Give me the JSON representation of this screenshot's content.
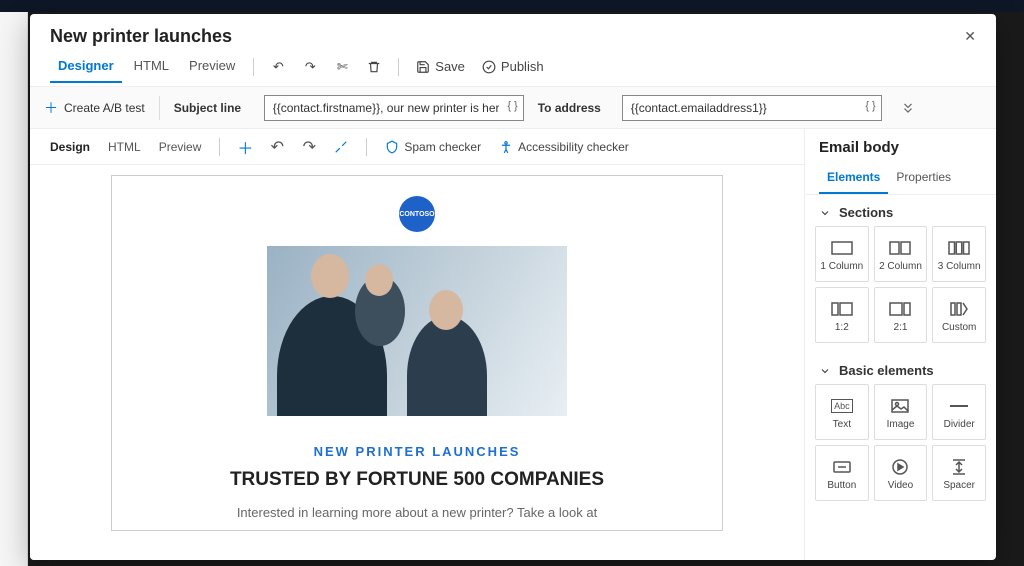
{
  "modal": {
    "title": "New printer launches"
  },
  "tabs": {
    "designer": "Designer",
    "html": "HTML",
    "preview": "Preview"
  },
  "toolbar": {
    "save": "Save",
    "publish": "Publish"
  },
  "config": {
    "ab": "Create A/B test",
    "subject_label": "Subject line",
    "subject_value": "{{contact.firstname}}, our new printer is here!",
    "to_label": "To address",
    "to_value": "{{contact.emailaddress1}}"
  },
  "canvas_tabs": {
    "design": "Design",
    "html": "HTML",
    "preview": "Preview"
  },
  "checkers": {
    "spam": "Spam checker",
    "access": "Accessibility checker"
  },
  "email": {
    "logo": "CONTOSO",
    "eyebrow": "NEW PRINTER LAUNCHES",
    "headline": "TRUSTED BY FORTUNE 500 COMPANIES",
    "lead": "Interested in learning more about a new printer? Take a look at"
  },
  "side": {
    "title": "Email body",
    "tabs": {
      "elements": "Elements",
      "properties": "Properties"
    },
    "sections_h": "Sections",
    "sections": [
      {
        "l": "1 Column"
      },
      {
        "l": "2 Column"
      },
      {
        "l": "3 Column"
      },
      {
        "l": "1:2"
      },
      {
        "l": "2:1"
      },
      {
        "l": "Custom"
      }
    ],
    "basic_h": "Basic elements",
    "basic": [
      {
        "l": "Text"
      },
      {
        "l": "Image"
      },
      {
        "l": "Divider"
      },
      {
        "l": "Button"
      },
      {
        "l": "Video"
      },
      {
        "l": "Spacer"
      }
    ]
  }
}
